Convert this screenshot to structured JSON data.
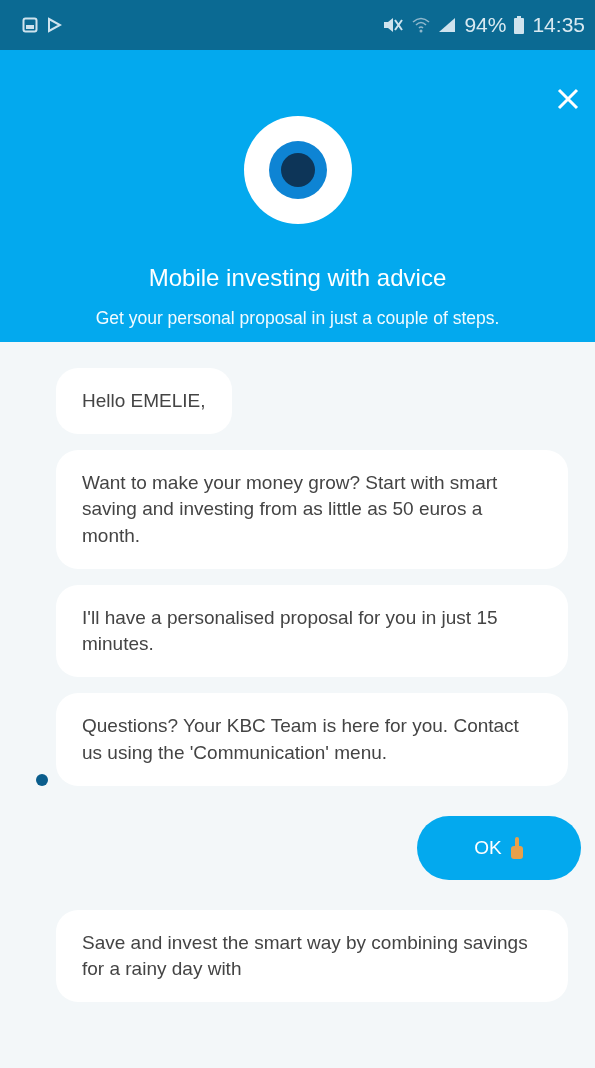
{
  "status_bar": {
    "battery": "94%",
    "time": "14:35"
  },
  "header": {
    "title": "Mobile investing with advice",
    "subtitle": "Get your personal proposal in just a couple of steps."
  },
  "messages": [
    {
      "kind": "bot",
      "text": "Hello EMELIE,"
    },
    {
      "kind": "bot",
      "text": "Want to make your money grow? Start with smart saving and investing from as little as 50 euros a month."
    },
    {
      "kind": "bot",
      "text": "I'll have a personalised proposal for you in just 15 minutes."
    },
    {
      "kind": "bot",
      "text": "Questions? Your KBC Team is here for you. Contact us using the 'Communication' menu."
    },
    {
      "kind": "reply",
      "text": "OK"
    },
    {
      "kind": "bot",
      "text": "Save and invest the smart way by combining savings for a rainy day with"
    }
  ]
}
